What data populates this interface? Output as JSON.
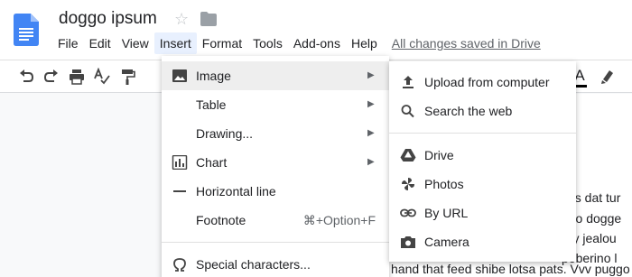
{
  "document": {
    "title": "doggo ipsum",
    "save_status": "All changes saved in Drive",
    "body_lines": [
      "oys dat tur",
      "rino dogge",
      "ery jealou",
      "poberino l",
      "hand that feed shibe lotsa pats. Vvv puggo"
    ]
  },
  "menubar": {
    "items": [
      "File",
      "Edit",
      "View",
      "Insert",
      "Format",
      "Tools",
      "Add-ons",
      "Help"
    ],
    "active": "Insert"
  },
  "insert_menu": {
    "items": [
      {
        "label": "Image",
        "icon": "image-icon",
        "submenu": true,
        "highlight": true
      },
      {
        "label": "Table",
        "icon": "",
        "submenu": true
      },
      {
        "label": "Drawing...",
        "icon": "",
        "submenu": true
      },
      {
        "label": "Chart",
        "icon": "chart-icon",
        "submenu": true
      },
      {
        "label": "Horizontal line",
        "icon": "horizontal-line-icon",
        "submenu": false
      },
      {
        "label": "Footnote",
        "icon": "",
        "shortcut": "⌘+Option+F"
      },
      {
        "label": "Special characters...",
        "icon": "omega-icon"
      }
    ],
    "submenu_arrow": "▶"
  },
  "image_submenu": {
    "items": [
      {
        "label": "Upload from computer",
        "icon": "upload-icon"
      },
      {
        "label": "Search the web",
        "icon": "search-icon"
      },
      {
        "label": "Drive",
        "icon": "drive-icon"
      },
      {
        "label": "Photos",
        "icon": "photos-icon"
      },
      {
        "label": "By URL",
        "icon": "link-icon"
      },
      {
        "label": "Camera",
        "icon": "camera-icon"
      }
    ]
  },
  "toolbar": {
    "text_color_label": "A"
  },
  "icons": {
    "star": "☆"
  },
  "colors": {
    "docs_blue": "#4285f4",
    "menu_active_bg": "#e8f0fe",
    "highlight_bg": "#eeeeee"
  }
}
